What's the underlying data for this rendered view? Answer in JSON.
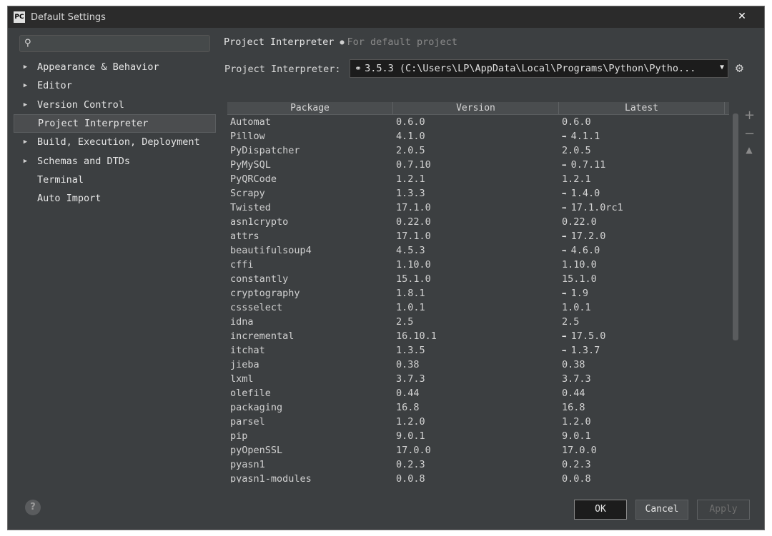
{
  "window": {
    "title": "Default Settings",
    "app_icon_text": "PC",
    "close_glyph": "✕"
  },
  "sidebar": {
    "search": {
      "value": "",
      "placeholder": ""
    },
    "items": [
      {
        "label": "Appearance & Behavior",
        "expandable": true,
        "selected": false
      },
      {
        "label": "Editor",
        "expandable": true,
        "selected": false
      },
      {
        "label": "Version Control",
        "expandable": true,
        "selected": false
      },
      {
        "label": "Project Interpreter",
        "expandable": false,
        "selected": true
      },
      {
        "label": "Build, Execution, Deployment",
        "expandable": true,
        "selected": false
      },
      {
        "label": "Schemas and DTDs",
        "expandable": true,
        "selected": false
      },
      {
        "label": "Terminal",
        "expandable": false,
        "selected": false
      },
      {
        "label": "Auto Import",
        "expandable": false,
        "selected": false
      }
    ]
  },
  "main": {
    "breadcrumb": {
      "title": "Project Interpreter",
      "subtitle": "For default project"
    },
    "interpreter": {
      "label": "Project Interpreter:",
      "value": "3.5.3 (C:\\Users\\LP\\AppData\\Local\\Programs\\Python\\Pytho..."
    },
    "table": {
      "headers": [
        "Package",
        "Version",
        "Latest"
      ],
      "rows": [
        {
          "package": "Automat",
          "version": "0.6.0",
          "latest": "0.6.0",
          "upgrade": false
        },
        {
          "package": "Pillow",
          "version": "4.1.0",
          "latest": "4.1.1",
          "upgrade": true
        },
        {
          "package": "PyDispatcher",
          "version": "2.0.5",
          "latest": "2.0.5",
          "upgrade": false
        },
        {
          "package": "PyMySQL",
          "version": "0.7.10",
          "latest": "0.7.11",
          "upgrade": true
        },
        {
          "package": "PyQRCode",
          "version": "1.2.1",
          "latest": "1.2.1",
          "upgrade": false
        },
        {
          "package": "Scrapy",
          "version": "1.3.3",
          "latest": "1.4.0",
          "upgrade": true
        },
        {
          "package": "Twisted",
          "version": "17.1.0",
          "latest": "17.1.0rc1",
          "upgrade": true
        },
        {
          "package": "asn1crypto",
          "version": "0.22.0",
          "latest": "0.22.0",
          "upgrade": false
        },
        {
          "package": "attrs",
          "version": "17.1.0",
          "latest": "17.2.0",
          "upgrade": true
        },
        {
          "package": "beautifulsoup4",
          "version": "4.5.3",
          "latest": "4.6.0",
          "upgrade": true
        },
        {
          "package": "cffi",
          "version": "1.10.0",
          "latest": "1.10.0",
          "upgrade": false
        },
        {
          "package": "constantly",
          "version": "15.1.0",
          "latest": "15.1.0",
          "upgrade": false
        },
        {
          "package": "cryptography",
          "version": "1.8.1",
          "latest": "1.9",
          "upgrade": true
        },
        {
          "package": "cssselect",
          "version": "1.0.1",
          "latest": "1.0.1",
          "upgrade": false
        },
        {
          "package": "idna",
          "version": "2.5",
          "latest": "2.5",
          "upgrade": false
        },
        {
          "package": "incremental",
          "version": "16.10.1",
          "latest": "17.5.0",
          "upgrade": true
        },
        {
          "package": "itchat",
          "version": "1.3.5",
          "latest": "1.3.7",
          "upgrade": true
        },
        {
          "package": "jieba",
          "version": "0.38",
          "latest": "0.38",
          "upgrade": false
        },
        {
          "package": "lxml",
          "version": "3.7.3",
          "latest": "3.7.3",
          "upgrade": false
        },
        {
          "package": "olefile",
          "version": "0.44",
          "latest": "0.44",
          "upgrade": false
        },
        {
          "package": "packaging",
          "version": "16.8",
          "latest": "16.8",
          "upgrade": false
        },
        {
          "package": "parsel",
          "version": "1.2.0",
          "latest": "1.2.0",
          "upgrade": false
        },
        {
          "package": "pip",
          "version": "9.0.1",
          "latest": "9.0.1",
          "upgrade": false
        },
        {
          "package": "pyOpenSSL",
          "version": "17.0.0",
          "latest": "17.0.0",
          "upgrade": false
        },
        {
          "package": "pyasn1",
          "version": "0.2.3",
          "latest": "0.2.3",
          "upgrade": false
        },
        {
          "package": "pyasn1-modules",
          "version": "0.0.8",
          "latest": "0.0.8",
          "upgrade": false
        }
      ]
    },
    "side_buttons": {
      "add": "+",
      "remove": "−",
      "upgrade": "▲"
    }
  },
  "footer": {
    "help": "?",
    "ok": "OK",
    "cancel": "Cancel",
    "apply": "Apply"
  },
  "icons": {
    "search": "search-icon",
    "gear": "gear-icon",
    "python": "python-icon",
    "upgrade_arrow": "upgrade-arrow-icon"
  },
  "colors": {
    "panel_bg": "#3c3f41",
    "titlebar_bg": "#2b2b2b",
    "selected_row": "#4b4d4f",
    "text": "#d2d2d2"
  }
}
